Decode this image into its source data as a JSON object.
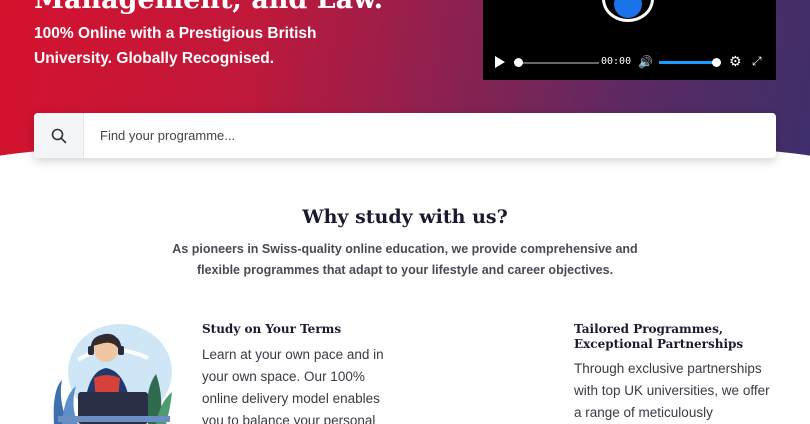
{
  "hero": {
    "title_partial": "Management, and Law.",
    "subtitle": "100% Online with a Prestigious British University. Globally Recognised."
  },
  "video_player": {
    "time": "00:00",
    "volume_level": 0.9,
    "progress_level": 0.0
  },
  "search": {
    "placeholder": "Find your programme..."
  },
  "why_section": {
    "title": "Why study with us?",
    "description": "As pioneers in Swiss-quality online education, we provide comprehensive and flexible programmes that adapt to your lifestyle and career objectives."
  },
  "features": [
    {
      "title": "Study on Your Terms",
      "body": "Learn at your own pace and in your own space. Our 100% online delivery model enables you to balance your personal"
    },
    {
      "title": "Tailored Programmes, Exceptional Partnerships",
      "body": "Through exclusive partnerships with top UK universities, we offer a range of meticulously"
    }
  ],
  "colors": {
    "hero_start": "#d4122e",
    "hero_end": "#3e2f6a",
    "accent_blue": "#1a73e8"
  }
}
